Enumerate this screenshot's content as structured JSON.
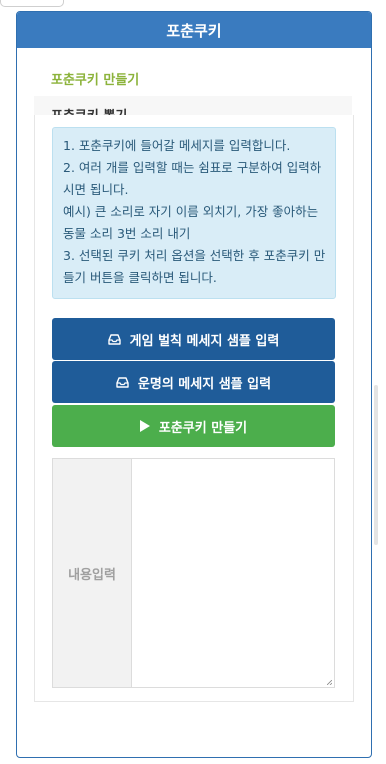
{
  "panel": {
    "title": "포춘쿠키"
  },
  "tabs": [
    {
      "label": "포춘쿠키 만들기"
    },
    {
      "label": "포춘쿠키 뽑기"
    }
  ],
  "notice": {
    "lines": [
      "1. 포춘쿠키에 들어갈 메세지를 입력합니다.",
      "2. 여러 개를 입력할 때는 쉼표로 구분하여 입력하시면 됩니다.",
      "예시) 큰 소리로 자기 이름 외치기, 가장 좋아하는 동물 소리 3번 소리 내기",
      "3. 선택된 쿠키 처리 옵션을 선택한 후 포춘쿠키 만들기 버튼을 클릭하면 됩니다."
    ]
  },
  "buttons": {
    "game_sample": "게임 벌칙 메세지 샘플 입력",
    "fortune_sample": "운명의 메세지 샘플 입력",
    "make": "포춘쿠키 만들기"
  },
  "input": {
    "label": "내용입력",
    "value": ""
  },
  "colors": {
    "header": "#3a7bbf",
    "active_tab": "#8cb33b",
    "primary_button": "#1f5c99",
    "success_button": "#4cae4c",
    "notice_bg": "#d9edf7"
  },
  "icons": {
    "sample_button": "inbox-icon",
    "make_button": "play-icon"
  }
}
